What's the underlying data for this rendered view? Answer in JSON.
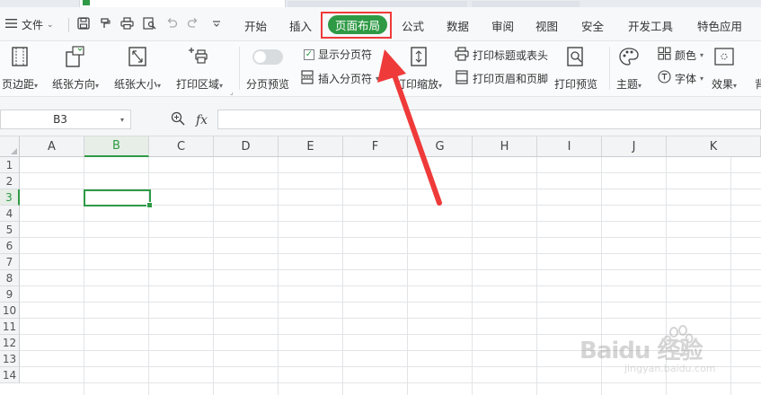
{
  "menubar": {
    "file_label": "文件",
    "tabs": [
      "开始",
      "插入",
      "公式",
      "数据",
      "审阅",
      "视图",
      "安全",
      "开发工具",
      "特色应用"
    ],
    "active_tab": "页面布局"
  },
  "ribbon": {
    "margins": "页边距",
    "orientation": "纸张方向",
    "size": "纸张大小",
    "print_area": "打印区域",
    "page_break_preview": "分页预览",
    "show_page_breaks": "显示分页符",
    "insert_page_break": "插入分页符",
    "print_scale": "打印缩放",
    "print_titles": "打印标题或表头",
    "print_header_footer": "打印页眉和页脚",
    "print_preview": "打印预览",
    "theme": "主题",
    "colors": "颜色",
    "fonts": "字体",
    "effects": "效果",
    "background_partial": "背"
  },
  "formula_bar": {
    "name_box": "B3",
    "fx": "fx",
    "content": ""
  },
  "sheet": {
    "columns": [
      "A",
      "B",
      "C",
      "D",
      "E",
      "F",
      "G",
      "H",
      "I",
      "J",
      "K"
    ],
    "rows": [
      "1",
      "2",
      "3",
      "4",
      "5",
      "6",
      "7",
      "8",
      "9",
      "10",
      "11",
      "12",
      "13",
      "14"
    ],
    "selected_column": "B",
    "selected_row": "3"
  },
  "watermark": {
    "brand": "Baidu 经验",
    "url": "jingyan.baidu.com"
  },
  "colors": {
    "accent_green": "#2e9a45",
    "highlight_red": "#ef3a3a"
  }
}
